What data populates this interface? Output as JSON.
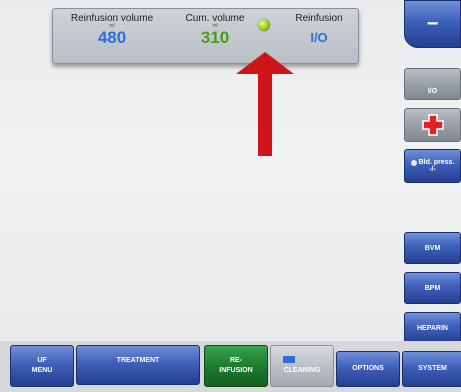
{
  "info_panel": {
    "reinfusion_volume": {
      "label": "Reinfusion volume",
      "unit": "ml",
      "value": "480",
      "color": "#2a6fe0"
    },
    "cum_volume": {
      "label": "Cum. volume",
      "unit": "ml",
      "value": "310",
      "color": "#4a9a1a"
    },
    "reinfusion": {
      "label": "Reinfusion",
      "value": "I/O",
      "color": "#2a6fe0"
    }
  },
  "right_panel": {
    "minus_symbol": "−",
    "io_label": "I/O",
    "bld_press_label": "Bld. press.",
    "bld_press_value": "-/-",
    "bvm_label": "BVM",
    "bpm_label": "BPM",
    "heparin_label": "HEPARIN"
  },
  "bottom_bar": {
    "uf_menu": "UF\nMENU",
    "treatment": "TREATMENT",
    "reinfusion": "RE-\nINFUSION",
    "cleaning": "CLEANING",
    "options": "OPTIONS",
    "system": "SYSTEM"
  },
  "colors": {
    "accent_red": "#d0141c",
    "button_blue": "#3f60b9",
    "button_green": "#1f7c31"
  }
}
